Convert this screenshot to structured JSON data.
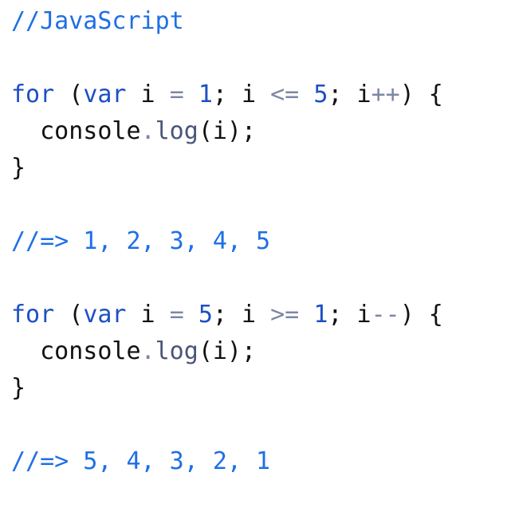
{
  "colors": {
    "comment": "#1e6fe6",
    "keyword": "#1d4fc4",
    "number": "#1d4fc4",
    "operator": "#7b87a3",
    "method": "#4a5578",
    "text": "#111111",
    "background": "#ffffff"
  },
  "code_lines": [
    [
      {
        "t": "//JavaScript",
        "k": "comment"
      }
    ],
    [],
    [
      {
        "t": "for",
        "k": "keyword"
      },
      {
        "t": " (",
        "k": "plain"
      },
      {
        "t": "var",
        "k": "keyword"
      },
      {
        "t": " i ",
        "k": "plain"
      },
      {
        "t": "=",
        "k": "op"
      },
      {
        "t": " ",
        "k": "plain"
      },
      {
        "t": "1",
        "k": "number"
      },
      {
        "t": "; i ",
        "k": "plain"
      },
      {
        "t": "<=",
        "k": "op"
      },
      {
        "t": " ",
        "k": "plain"
      },
      {
        "t": "5",
        "k": "number"
      },
      {
        "t": "; i",
        "k": "plain"
      },
      {
        "t": "++",
        "k": "op"
      },
      {
        "t": ") {",
        "k": "plain"
      }
    ],
    [
      {
        "t": "  console",
        "k": "plain"
      },
      {
        "t": ".",
        "k": "op"
      },
      {
        "t": "log",
        "k": "method"
      },
      {
        "t": "(i);",
        "k": "plain"
      }
    ],
    [
      {
        "t": "}",
        "k": "plain"
      }
    ],
    [],
    [
      {
        "t": "//=> 1, 2, 3, 4, 5",
        "k": "comment"
      }
    ],
    [],
    [
      {
        "t": "for",
        "k": "keyword"
      },
      {
        "t": " (",
        "k": "plain"
      },
      {
        "t": "var",
        "k": "keyword"
      },
      {
        "t": " i ",
        "k": "plain"
      },
      {
        "t": "=",
        "k": "op"
      },
      {
        "t": " ",
        "k": "plain"
      },
      {
        "t": "5",
        "k": "number"
      },
      {
        "t": "; i ",
        "k": "plain"
      },
      {
        "t": ">=",
        "k": "op"
      },
      {
        "t": " ",
        "k": "plain"
      },
      {
        "t": "1",
        "k": "number"
      },
      {
        "t": "; i",
        "k": "plain"
      },
      {
        "t": "--",
        "k": "op"
      },
      {
        "t": ") {",
        "k": "plain"
      }
    ],
    [
      {
        "t": "  console",
        "k": "plain"
      },
      {
        "t": ".",
        "k": "op"
      },
      {
        "t": "log",
        "k": "method"
      },
      {
        "t": "(i);",
        "k": "plain"
      }
    ],
    [
      {
        "t": "}",
        "k": "plain"
      }
    ],
    [],
    [
      {
        "t": "//=> 5, 4, 3, 2, 1",
        "k": "comment"
      }
    ]
  ]
}
